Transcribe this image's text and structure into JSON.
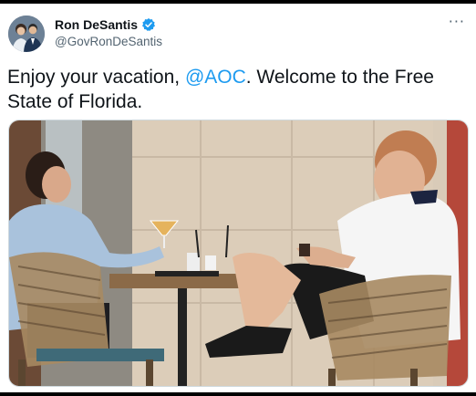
{
  "tweet": {
    "author_name": "Ron DeSantis",
    "handle": "@GovRonDeSantis",
    "verified": true,
    "text_before": "Enjoy your vacation, ",
    "mention": "@AOC",
    "text_after": ". Welcome to the Free State of Florida.",
    "more_icon": "more-horizontal-icon"
  },
  "colors": {
    "link": "#1d9bf0",
    "text": "#0f1419",
    "secondary": "#536471",
    "verified": "#1d9bf0"
  }
}
